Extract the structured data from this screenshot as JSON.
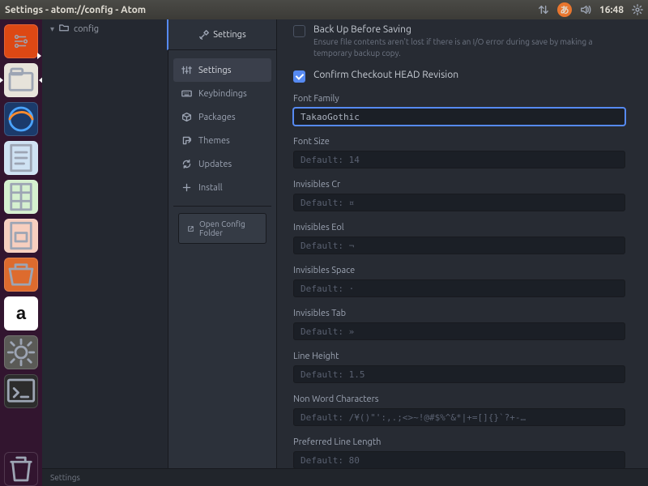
{
  "topbar": {
    "title": "Settings - atom://config - Atom",
    "clock": "16:48",
    "ime": "あ"
  },
  "tree": {
    "project": "config"
  },
  "tab": {
    "label": "Settings"
  },
  "sidenav": {
    "items": [
      {
        "label": "Settings"
      },
      {
        "label": "Keybindings"
      },
      {
        "label": "Packages"
      },
      {
        "label": "Themes"
      },
      {
        "label": "Updates"
      },
      {
        "label": "Install"
      }
    ],
    "open_config": "Open Config Folder"
  },
  "settings": {
    "backup": {
      "label": "Back Up Before Saving",
      "desc": "Ensure file contents aren't lost if there is an I/O error during save by making a temporary backup copy."
    },
    "confirm_head": {
      "label": "Confirm Checkout HEAD Revision"
    },
    "font_family": {
      "label": "Font Family",
      "value": "TakaoGothic"
    },
    "font_size": {
      "label": "Font Size",
      "placeholder": "Default: 14"
    },
    "inv_cr": {
      "label": "Invisibles Cr",
      "placeholder": "Default: ¤"
    },
    "inv_eol": {
      "label": "Invisibles Eol",
      "placeholder": "Default: ¬"
    },
    "inv_space": {
      "label": "Invisibles Space",
      "placeholder": "Default: ·"
    },
    "inv_tab": {
      "label": "Invisibles Tab",
      "placeholder": "Default: »"
    },
    "line_height": {
      "label": "Line Height",
      "placeholder": "Default: 1.5"
    },
    "non_word": {
      "label": "Non Word Characters",
      "placeholder": "Default: /¥()\"':,.;<>~!@#$%^&*|+=[]{}`?+-…"
    },
    "pref_len": {
      "label": "Preferred Line Length",
      "placeholder": "Default: 80"
    }
  },
  "status": {
    "left": "Settings"
  }
}
